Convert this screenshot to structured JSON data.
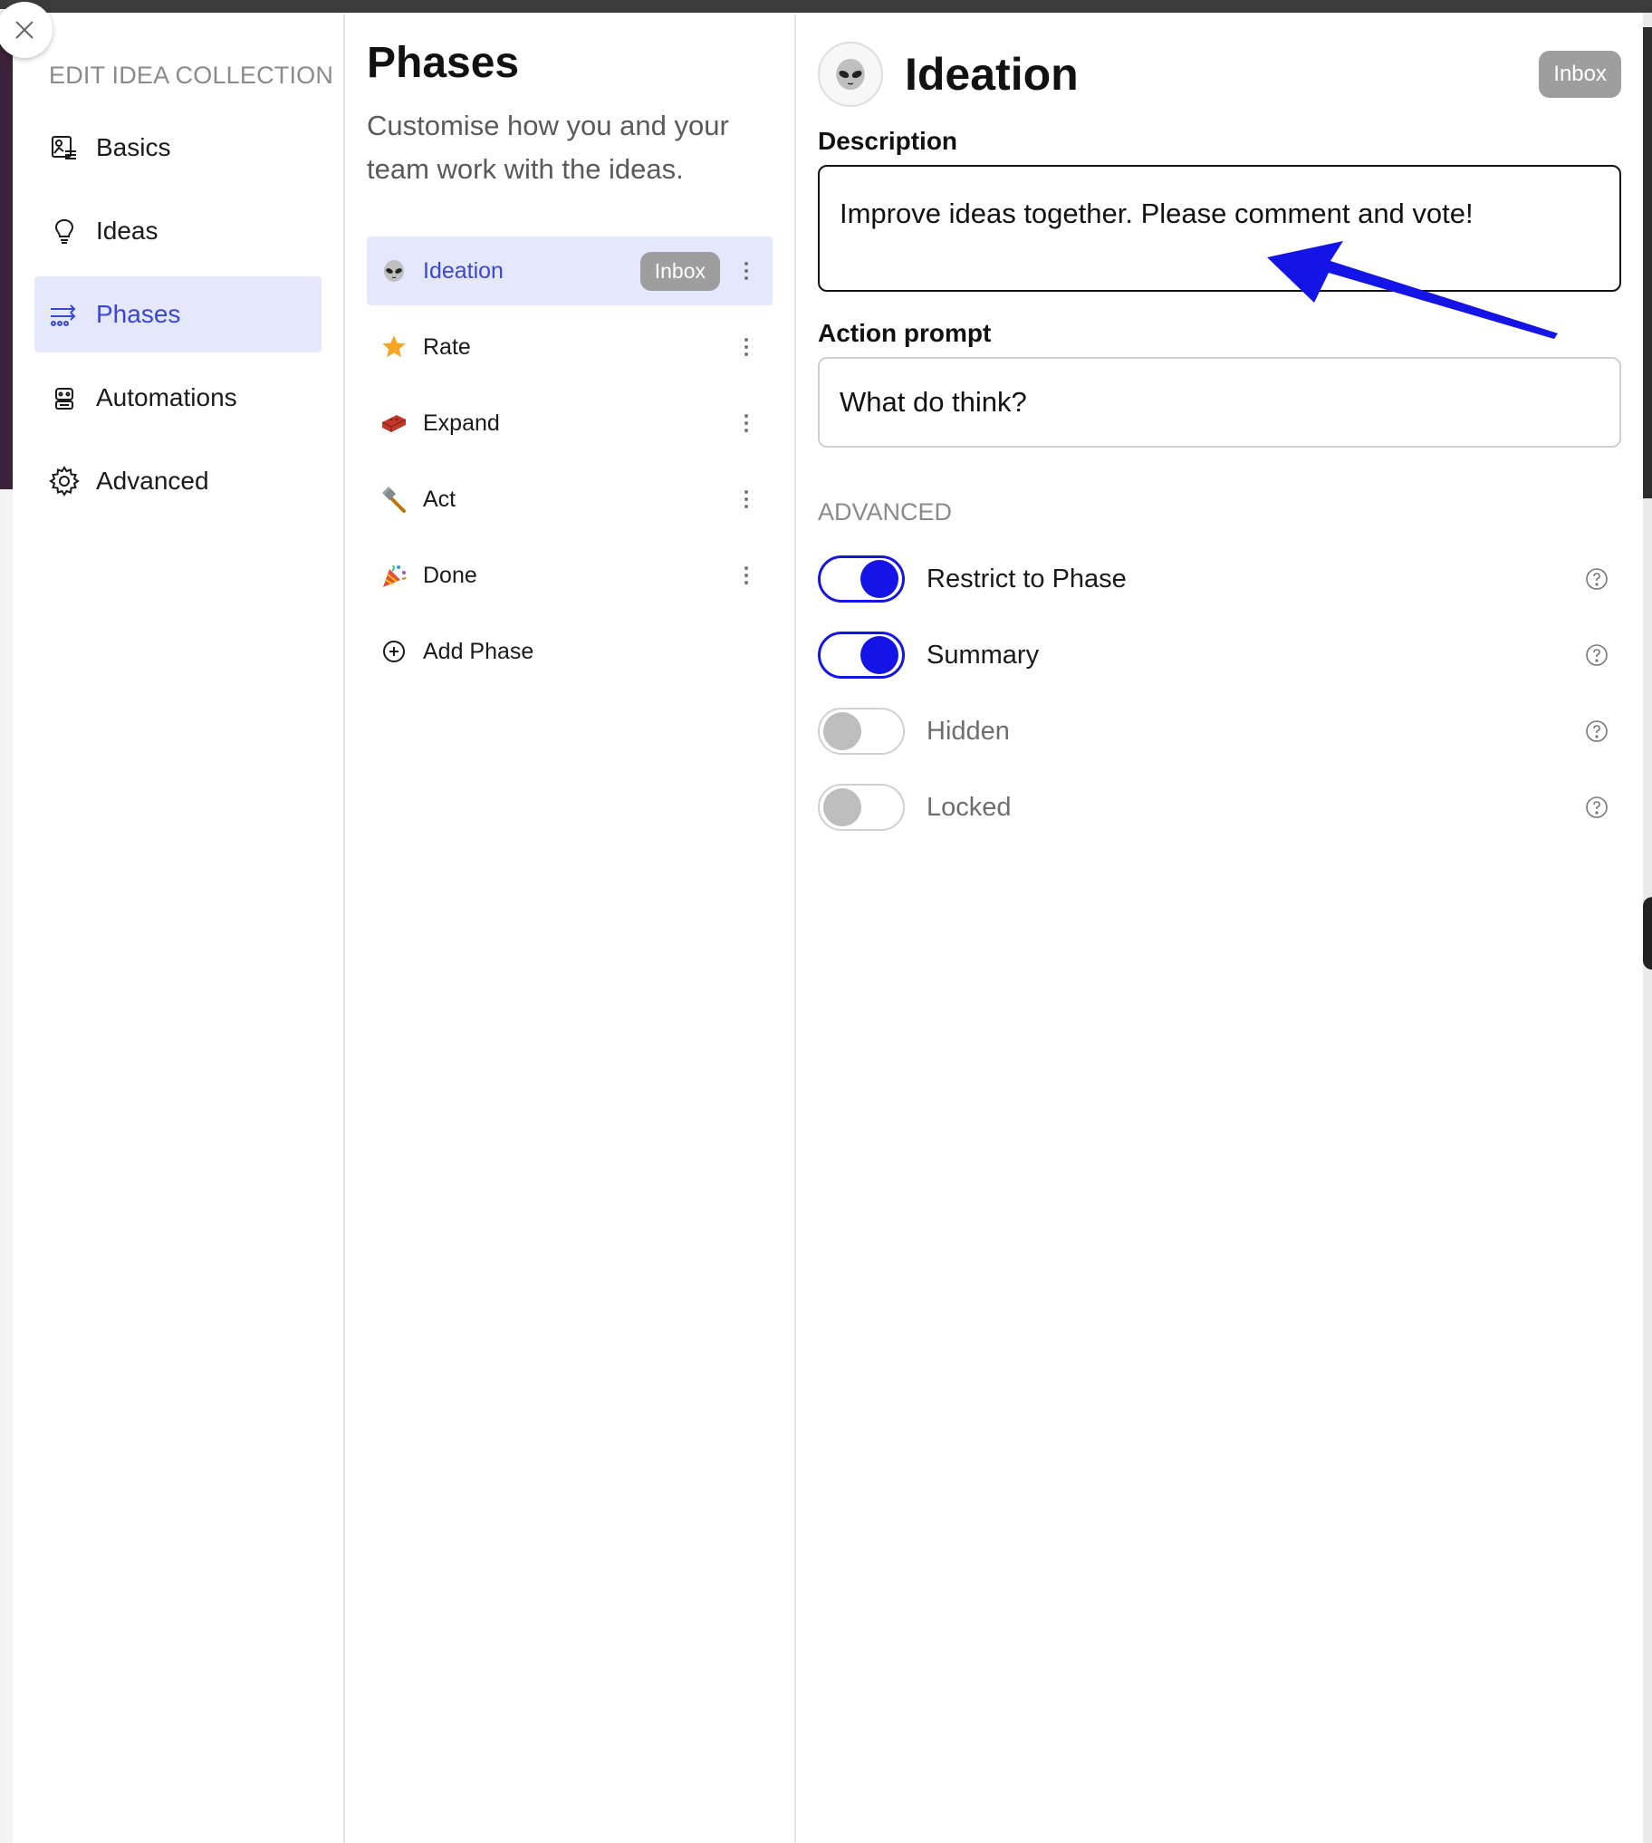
{
  "nav": {
    "heading": "EDIT IDEA COLLECTION",
    "items": [
      {
        "label": "Basics",
        "icon": "basics-icon"
      },
      {
        "label": "Ideas",
        "icon": "lightbulb-icon"
      },
      {
        "label": "Phases",
        "icon": "phases-icon",
        "active": true
      },
      {
        "label": "Automations",
        "icon": "robot-icon"
      },
      {
        "label": "Advanced",
        "icon": "gear-icon"
      }
    ]
  },
  "phases": {
    "title": "Phases",
    "subtitle": "Customise how you and your team work with the ideas.",
    "items": [
      {
        "label": "Ideation",
        "icon": "alien-emoji",
        "badge": "Inbox",
        "active": true
      },
      {
        "label": "Rate",
        "icon": "star-emoji"
      },
      {
        "label": "Expand",
        "icon": "brick-emoji"
      },
      {
        "label": "Act",
        "icon": "hammer-emoji"
      },
      {
        "label": "Done",
        "icon": "party-popper-emoji"
      }
    ],
    "add_label": "Add Phase"
  },
  "detail": {
    "title": "Ideation",
    "badge": "Inbox",
    "description_label": "Description",
    "description_value": "Improve ideas together. Please comment and vote!",
    "action_prompt_label": "Action prompt",
    "action_prompt_value": "What do think?",
    "advanced_heading": "ADVANCED",
    "toggles": [
      {
        "label": "Restrict to Phase",
        "on": true
      },
      {
        "label": "Summary",
        "on": true
      },
      {
        "label": "Hidden",
        "on": false
      },
      {
        "label": "Locked",
        "on": false
      }
    ]
  },
  "colors": {
    "accent": "#3a46d6",
    "toggle_on": "#1414e6",
    "active_bg": "#e5e7fd",
    "badge_bg": "#9e9e9e",
    "annotation_arrow": "#1414e6"
  }
}
